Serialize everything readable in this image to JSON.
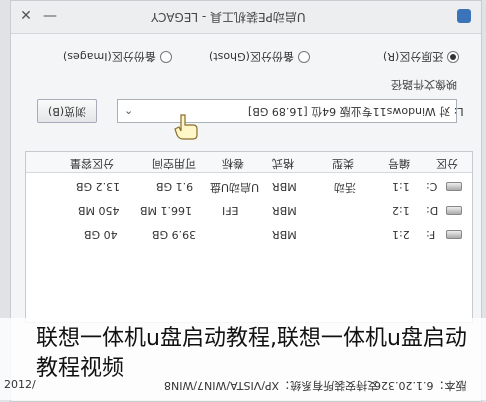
{
  "window": {
    "title": "U启动PE装机工具 - LEGACY",
    "close_glyph": "✕",
    "minimize_glyph": "—"
  },
  "options": {
    "restore_label": "还原分区(R)",
    "backup_ghost_label": "备份分区(Ghost)",
    "backup_images_label": "备份分区(Images)"
  },
  "image_section": {
    "label": "映像文件路径",
    "browse_label": "浏览(B)",
    "path_value": "L: 对 Windows11专业版 64位 [16.89 GB]"
  },
  "table": {
    "headers": [
      "分区",
      "编号",
      "类型",
      "格式",
      "卷标",
      "可用空间",
      "分区容量"
    ],
    "rows": [
      {
        "drive": "C:",
        "num": "1:1",
        "type": "活动",
        "format": "MBR",
        "label": "U启动U盘",
        "free": "9.1 GB",
        "size": "13.2 GB"
      },
      {
        "drive": "D:",
        "num": "1:2",
        "type": "",
        "format": "MBR",
        "label": "EFI",
        "free": "166.1 MB",
        "size": "450 MB"
      },
      {
        "drive": "F:",
        "num": "2:1",
        "type": "",
        "format": "MBR",
        "label": "",
        "free": "39.9 GB",
        "size": "40 GB"
      }
    ]
  },
  "status": {
    "left": "2012/",
    "middle": "支持安装所有系统：XP/VISTA/WIN7/WIN8",
    "right": "版本：6.1.20.326"
  },
  "caption": "联想一体机u盘启动教程,联想一体机u盘启动教程视频"
}
